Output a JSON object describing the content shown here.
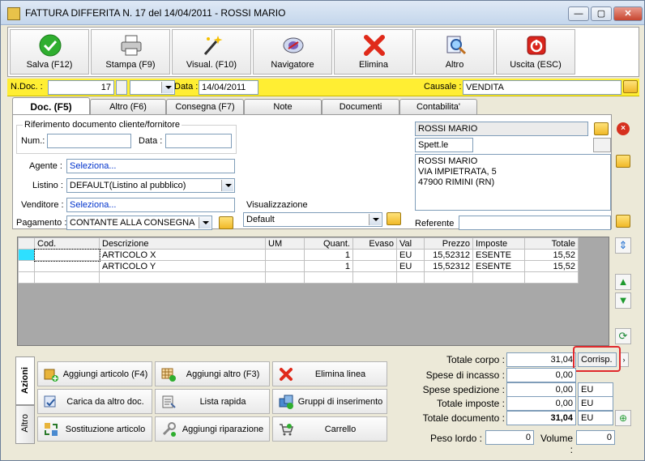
{
  "window": {
    "title": "FATTURA DIFFERITA N. 17  del 14/04/2011 - ROSSI MARIO",
    "min": "—",
    "max": "▢",
    "close": "✕"
  },
  "toolbar": [
    {
      "label": "Salva (F12)",
      "icon": "save-check-icon"
    },
    {
      "label": "Stampa (F9)",
      "icon": "printer-icon"
    },
    {
      "label": "Visual. (F10)",
      "icon": "magic-wand-icon"
    },
    {
      "label": "Navigatore",
      "icon": "navigator-icon"
    },
    {
      "label": "Elimina",
      "icon": "delete-x-icon"
    },
    {
      "label": "Altro",
      "icon": "magnifier-icon"
    },
    {
      "label": "Uscita (ESC)",
      "icon": "exit-icon"
    }
  ],
  "header": {
    "ndoc_label": "N.Doc. :",
    "ndoc_value": "17",
    "data_label": "Data :",
    "data_value": "14/04/2011",
    "causale_label": "Causale :",
    "causale_value": "VENDITA"
  },
  "tabs": [
    "Doc. (F5)",
    "Altro (F6)",
    "Consegna (F7)",
    "Note",
    "Documenti",
    "Contabilita'"
  ],
  "doc": {
    "rif_label": "Riferimento documento cliente/fornitore",
    "num_label": "Num.:",
    "num_value": "",
    "data_label": "Data :",
    "data_value": "",
    "agente_label": "Agente :",
    "agente_value": "Seleziona...",
    "listino_label": "Listino :",
    "listino_value": "DEFAULT(Listino al pubblico)",
    "venditore_label": "Venditore :",
    "venditore_value": "Seleziona...",
    "pagamento_label": "Pagamento :",
    "pagamento_value": "CONTANTE ALLA CONSEGNA",
    "visualizzazione_label": "Visualizzazione",
    "visualizzazione_value": "Default",
    "cliente_name": "ROSSI MARIO",
    "spett": "Spett.le",
    "address": [
      "ROSSI MARIO",
      "VIA IMPIETRATA, 5",
      "47900 RIMINI (RN)"
    ],
    "referente_label": "Referente",
    "referente_value": ""
  },
  "grid": {
    "columns": [
      "Cod.",
      "Descrizione",
      "UM",
      "Quant.",
      "Evaso",
      "Val",
      "Prezzo",
      "Imposte",
      "Totale"
    ],
    "rows": [
      [
        "",
        "ARTICOLO X",
        "",
        "1",
        "",
        "EU",
        "15,52312",
        "ESENTE",
        "15,52"
      ],
      [
        "",
        "ARTICOLO Y",
        "",
        "1",
        "",
        "EU",
        "15,52312",
        "ESENTE",
        "15,52"
      ]
    ]
  },
  "actions": {
    "vtabs": [
      "Azioni",
      "Altro"
    ],
    "buttons": [
      [
        "Aggiungi articolo (F4)",
        "Aggiungi altro (F3)",
        "Elimina linea"
      ],
      [
        "Carica da altro doc.",
        "Lista rapida",
        "Gruppi di inserimento"
      ],
      [
        "Sostituzione articolo",
        "Aggiungi riparazione",
        "Carrello"
      ]
    ]
  },
  "totals": {
    "corpo_label": "Totale corpo :",
    "corpo_value": "31,04",
    "corrisp": "Corrisp.",
    "incasso_label": "Spese di incasso :",
    "incasso_value": "0,00",
    "spedizione_label": "Spese spedizione :",
    "spedizione_value": "0,00",
    "spedizione_cur": "EU",
    "imposte_label": "Totale imposte :",
    "imposte_value": "0,00",
    "imposte_cur": "EU",
    "documento_label": "Totale documento :",
    "documento_value": "31,04",
    "documento_cur": "EU",
    "peso_label": "Peso lordo :",
    "peso_value": "0",
    "volume_label": "Volume :",
    "volume_value": "0"
  }
}
